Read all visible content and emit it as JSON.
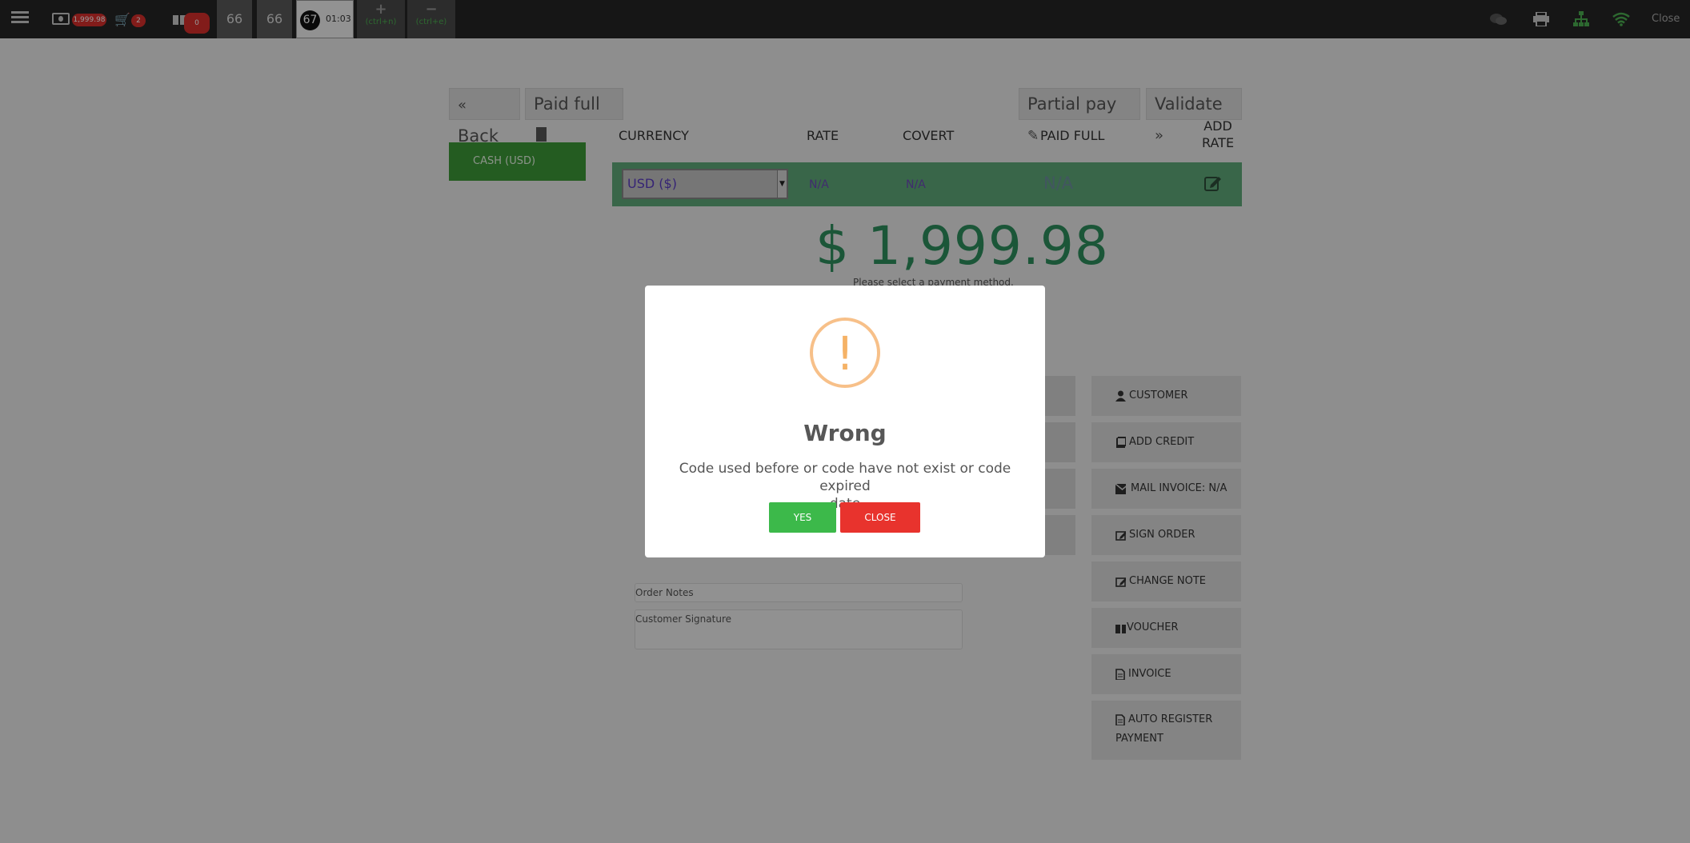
{
  "topbar": {
    "cash_badge": "1,999.98",
    "cart_badge": "2",
    "voucher_badge": "0",
    "tab_1": "66",
    "tab_2": "66",
    "active_tab_number": "67",
    "active_tab_time": "01:03",
    "increase_hotkey": "(ctrl+n)",
    "decrease_hotkey": "(ctrl+e)",
    "close_label": "Close"
  },
  "payment": {
    "back_label": "Back",
    "paid_full_label": "Paid full",
    "partial_pay_label": "Partial pay",
    "validate_label": "Validate",
    "method_cash_label": "CASH (USD)",
    "col_currency": "CURRENCY",
    "col_rate": "RATE",
    "col_covert": "COVERT",
    "col_paid_full": "PAID FULL",
    "col_add_rate_1": "ADD",
    "col_add_rate_2": "RATE",
    "currency_value": "USD ($)",
    "rate_value": "N/A",
    "covert_value": "N/A",
    "paid_full_value": "N/A",
    "total_amount": "$ 1,999.98",
    "hint": "Please select a payment method."
  },
  "actions": {
    "customer": "CUSTOMER",
    "add_credit": "ADD CREDIT",
    "mail_invoice": "MAIL INVOICE: N/A",
    "sign_order": "SIGN ORDER",
    "change_note": "CHANGE NOTE",
    "voucher": "VOUCHER",
    "invoice": "INVOICE",
    "auto_register_1": "AUTO REGISTER",
    "auto_register_2": "PAYMENT"
  },
  "notes": {
    "order_notes": "Order Notes",
    "customer_signature": "Customer Signature"
  },
  "modal": {
    "title": "Wrong",
    "message_line1": "Code used before or code have not exist or code expired",
    "message_line2": "date",
    "yes_label": "YES",
    "close_label": "CLOSE"
  },
  "colors": {
    "primary_green": "#3c9a38",
    "row_green": "#5faa7a",
    "amount_green": "#2e8f5e",
    "yes_green": "#3cb94a",
    "close_red": "#e8332d",
    "warning_orange": "#f7c089"
  }
}
